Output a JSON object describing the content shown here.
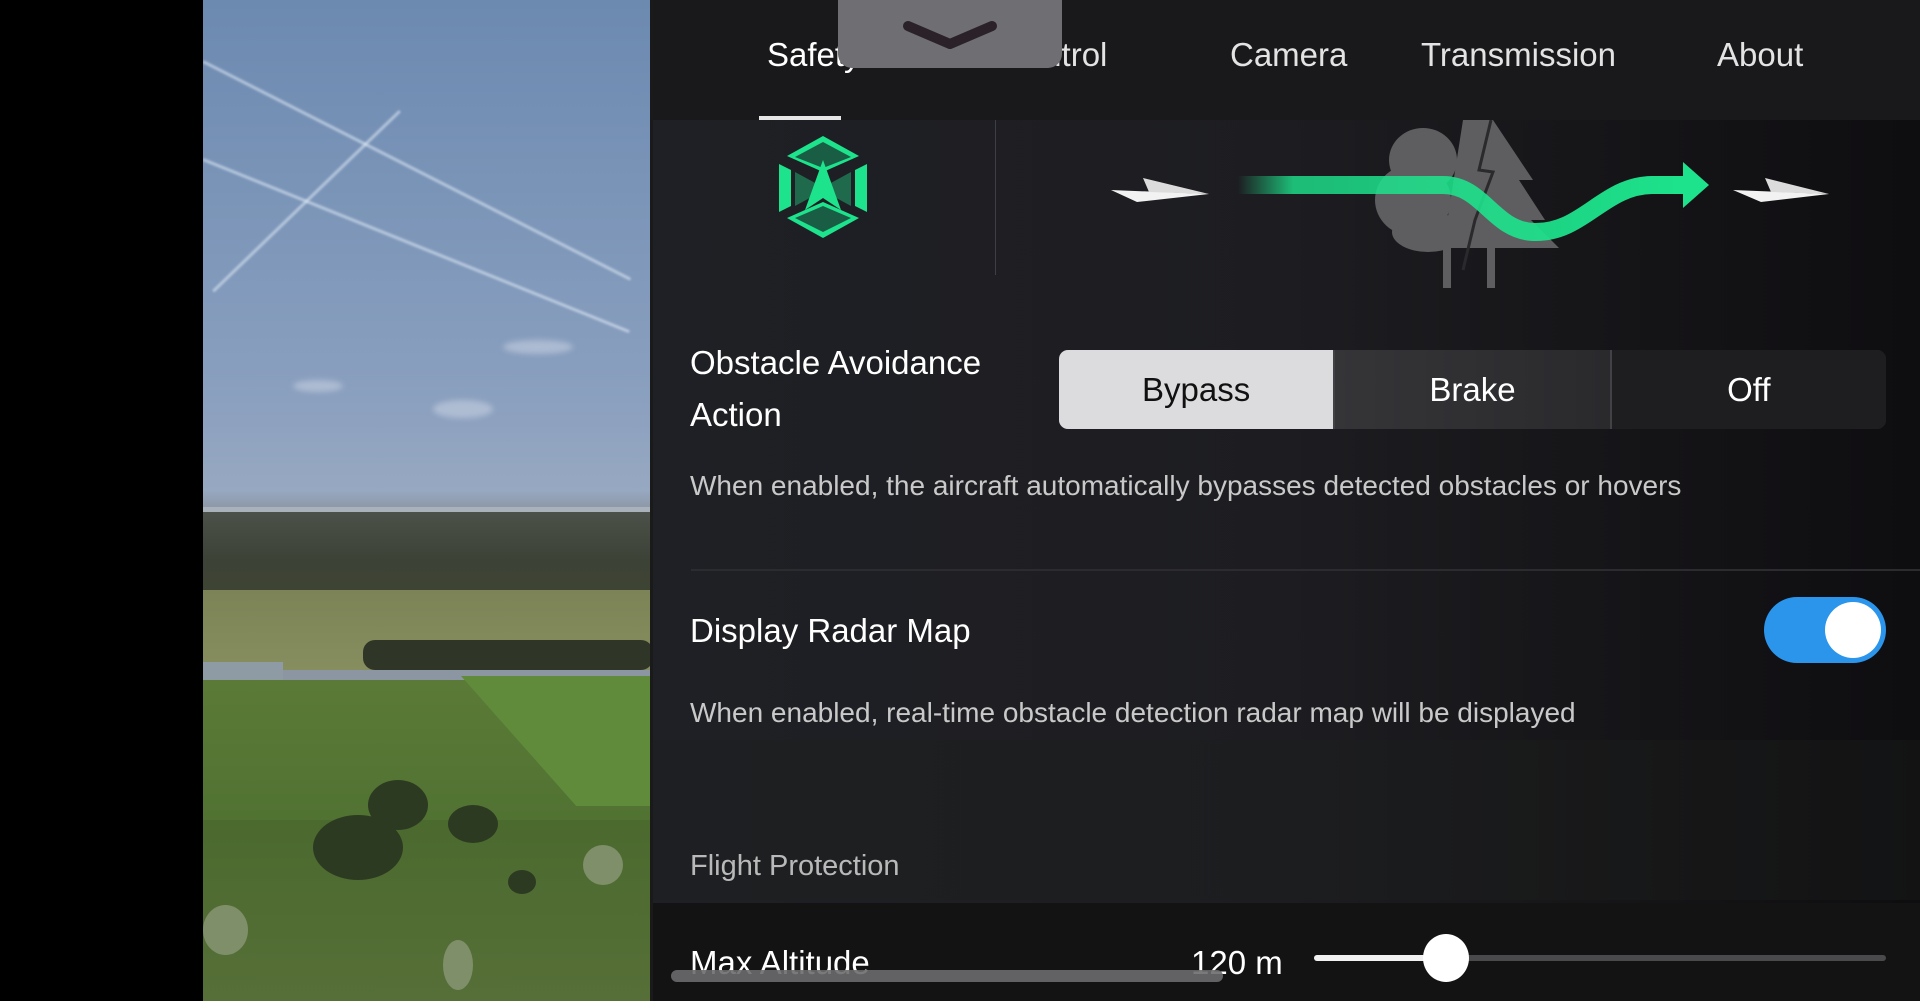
{
  "tabs": [
    {
      "label": "Safety",
      "active": true
    },
    {
      "label": "Control",
      "active": false
    },
    {
      "label": "Camera",
      "active": false
    },
    {
      "label": "Transmission",
      "active": false
    },
    {
      "label": "About",
      "active": false
    }
  ],
  "pull_handle": {
    "icon": "chevron-down-icon"
  },
  "illustration": {
    "icons": [
      "obstacle-avoidance-shield-icon",
      "paper-plane-icon",
      "tree-obstacle-icon",
      "bypass-path-arrow-icon",
      "paper-plane-icon"
    ],
    "accent_color": "#1de38c"
  },
  "obstacle_avoidance": {
    "title_line1": "Obstacle Avoidance",
    "title_line2": "Action",
    "options": [
      "Bypass",
      "Brake",
      "Off"
    ],
    "selected": "Bypass",
    "description": "When enabled, the aircraft automatically bypasses detected obstacles or hovers"
  },
  "radar_map": {
    "title": "Display Radar Map",
    "enabled": true,
    "toggle_color": "#2b95ec",
    "description": "When enabled, real-time obstacle detection radar map will be displayed"
  },
  "flight_protection": {
    "section_label": "Flight Protection",
    "max_altitude": {
      "label": "Max Altitude",
      "value_text": "120 m",
      "slider_fraction": 0.23
    }
  }
}
